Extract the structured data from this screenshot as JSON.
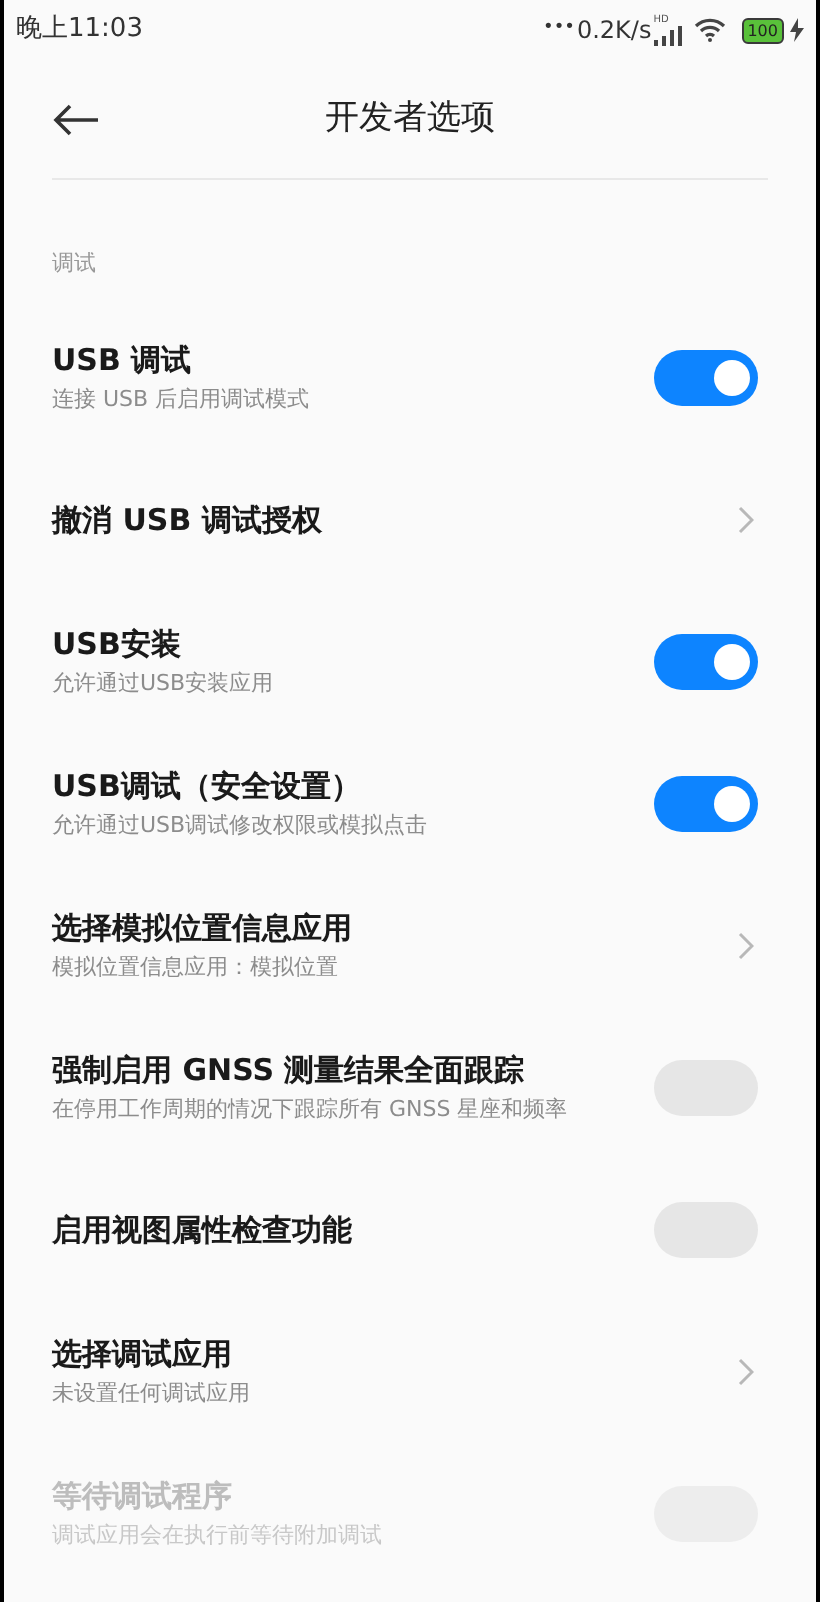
{
  "status_bar": {
    "time": "晚上11:03",
    "dots": "•••",
    "speed": "0.2K/s",
    "signal_tag": "HD",
    "battery": "100"
  },
  "header": {
    "title": "开发者选项"
  },
  "section": {
    "label": "调试"
  },
  "rows": [
    {
      "kind": "toggle",
      "title": "USB 调试",
      "subtitle": "连接 USB 后启用调试模式",
      "on": true,
      "disabled": false
    },
    {
      "kind": "link",
      "title": "撤消 USB 调试授权",
      "disabled": false
    },
    {
      "kind": "toggle",
      "title": "USB安装",
      "subtitle": "允许通过USB安装应用",
      "on": true,
      "disabled": false
    },
    {
      "kind": "toggle",
      "title": "USB调试（安全设置）",
      "subtitle": "允许通过USB调试修改权限或模拟点击",
      "on": true,
      "disabled": false
    },
    {
      "kind": "link",
      "title": "选择模拟位置信息应用",
      "subtitle": "模拟位置信息应用：模拟位置",
      "disabled": false
    },
    {
      "kind": "toggle",
      "title": "强制启用 GNSS 测量结果全面跟踪",
      "subtitle": "在停用工作周期的情况下跟踪所有 GNSS 星座和频率",
      "on": false,
      "disabled": false
    },
    {
      "kind": "toggle",
      "title": "启用视图属性检查功能",
      "on": false,
      "disabled": false
    },
    {
      "kind": "link",
      "title": "选择调试应用",
      "subtitle": "未设置任何调试应用",
      "disabled": false
    },
    {
      "kind": "toggle",
      "title": "等待调试程序",
      "subtitle": "调试应用会在执行前等待附加调试",
      "on": false,
      "disabled": true
    }
  ]
}
